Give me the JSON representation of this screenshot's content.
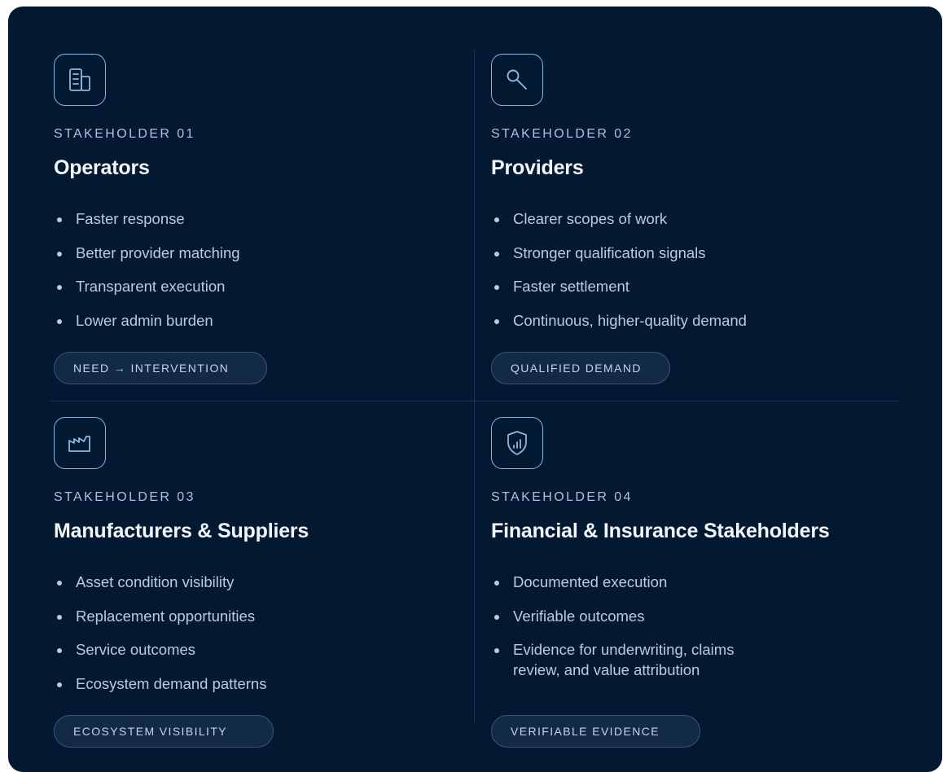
{
  "cards": [
    {
      "icon": "building-icon",
      "eyebrow": "STAKEHOLDER 01",
      "title": "Operators",
      "bullets": [
        "Faster response",
        "Better provider matching",
        "Transparent execution",
        "Lower admin burden"
      ],
      "tag": "NEED → INTERVENTION"
    },
    {
      "icon": "search-icon",
      "eyebrow": "STAKEHOLDER 02",
      "title": "Providers",
      "bullets": [
        "Clearer scopes of work",
        "Stronger qualification signals",
        "Faster settlement",
        "Continuous, higher-quality demand"
      ],
      "tag": "QUALIFIED DEMAND"
    },
    {
      "icon": "factory-icon",
      "eyebrow": "STAKEHOLDER 03",
      "title": "Manufacturers & Suppliers",
      "bullets": [
        "Asset condition visibility",
        "Replacement opportunities",
        "Service outcomes",
        "Ecosystem demand patterns"
      ],
      "tag": "ECOSYSTEM VISIBILITY"
    },
    {
      "icon": "shield-chart-icon",
      "eyebrow": "STAKEHOLDER 04",
      "title": "Financial & Insurance Stakeholders",
      "bullets": [
        "Documented execution",
        "Verifiable outcomes",
        "Evidence for underwriting, claims review, and value attribution"
      ],
      "tag": "VERIFIABLE EVIDENCE"
    }
  ],
  "colors": {
    "panel_background": "#031932",
    "icon_stroke": "#8fb7dc",
    "tag_background": "#132a46"
  }
}
